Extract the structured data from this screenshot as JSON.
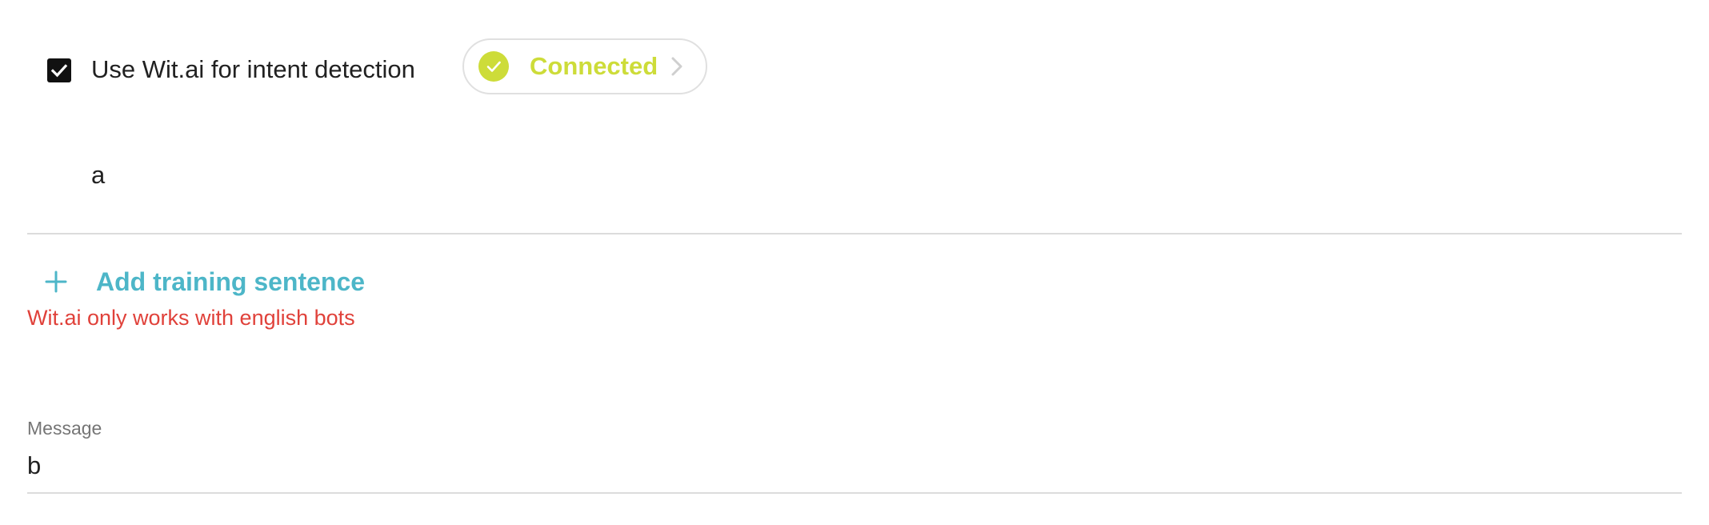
{
  "nlp": {
    "checkbox_label": "Use Wit.ai for intent detection",
    "checked": true,
    "status": {
      "label": "Connected",
      "icon": "check-circle-icon",
      "color": "#cddc39"
    }
  },
  "training": {
    "sentences": [
      "a"
    ],
    "add_label": "Add training sentence",
    "add_icon": "plus-icon",
    "accent_color": "#4db6c8"
  },
  "warning": {
    "text": "Wit.ai only works with english bots",
    "color": "#e0413a"
  },
  "message": {
    "label": "Message",
    "value": "b"
  }
}
